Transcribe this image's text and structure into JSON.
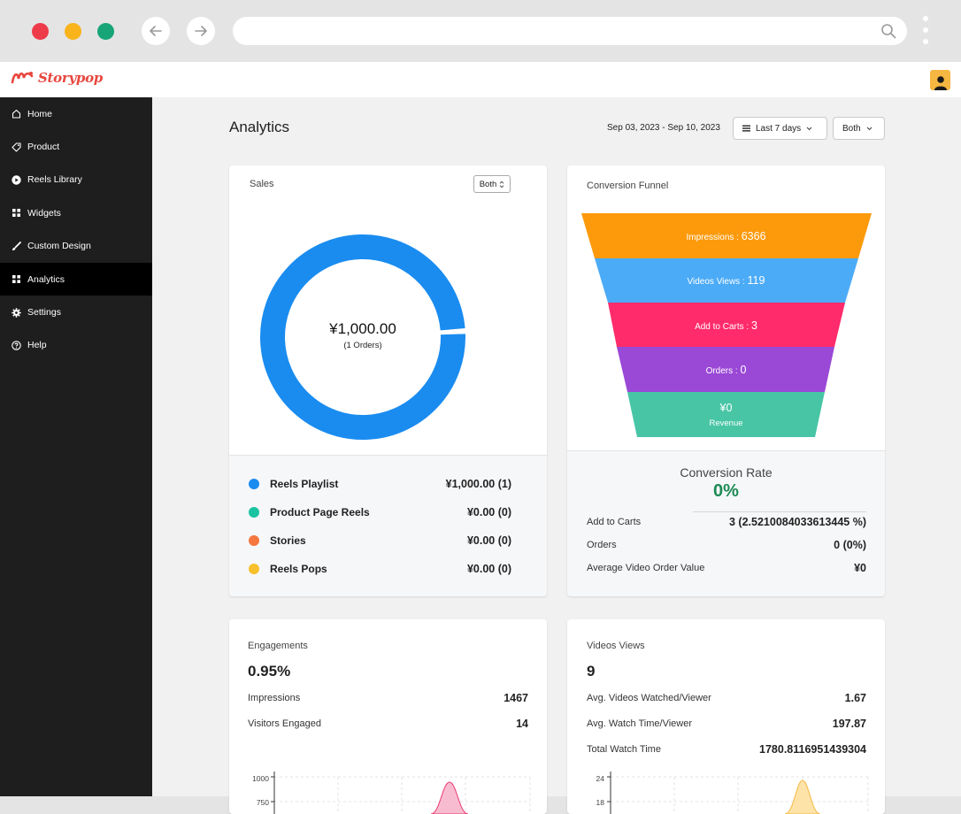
{
  "app": {
    "logo_text": "Storypop"
  },
  "sidebar": {
    "items": [
      {
        "label": "Home",
        "icon": "home-icon"
      },
      {
        "label": "Product",
        "icon": "tag-icon"
      },
      {
        "label": "Reels Library",
        "icon": "play-circle-icon"
      },
      {
        "label": "Widgets",
        "icon": "grid-icon"
      },
      {
        "label": "Custom Design",
        "icon": "brush-icon"
      },
      {
        "label": "Analytics",
        "icon": "grid-icon",
        "active": true
      },
      {
        "label": "Settings",
        "icon": "gear-icon"
      },
      {
        "label": "Help",
        "icon": "help-circle-icon"
      }
    ]
  },
  "header": {
    "title": "Analytics",
    "date_range": "Sep 03, 2023 - Sep 10, 2023",
    "period_select": "Last 7 days",
    "type_select": "Both"
  },
  "sales": {
    "title": "Sales",
    "filter": "Both",
    "total": "¥1,000.00",
    "orders": "(1 Orders)",
    "accent": "#1a8cf0",
    "legend": [
      {
        "label": "Reels Playlist",
        "value": "¥1,000.00 (1)",
        "color": "#1a8cf0"
      },
      {
        "label": "Product Page Reels",
        "value": "¥0.00 (0)",
        "color": "#19c2a0"
      },
      {
        "label": "Stories",
        "value": "¥0.00 (0)",
        "color": "#f5773f"
      },
      {
        "label": "Reels Pops",
        "value": "¥0.00 (0)",
        "color": "#f7c02c"
      }
    ]
  },
  "funnel": {
    "title": "Conversion Funnel",
    "stages": [
      {
        "label": "Impressions : ",
        "value": "6366",
        "color": "#fc9a0c"
      },
      {
        "label": "Videos Views : ",
        "value": "119",
        "color": "#4cabf7"
      },
      {
        "label": "Add to Carts : ",
        "value": "3",
        "color": "#ff2b6a"
      },
      {
        "label": "Orders : ",
        "value": "0",
        "color": "#9a48d6"
      },
      {
        "label": "Revenue",
        "value": "¥0",
        "color": "#47c5a5"
      }
    ],
    "conversion_title": "Conversion Rate",
    "conversion_value": "0%",
    "rows": [
      {
        "label": "Add to Carts",
        "value": "3 (2.5210084033613445 %)"
      },
      {
        "label": "Orders",
        "value": "0 (0%)"
      },
      {
        "label": "Average Video Order Value",
        "value": "¥0"
      }
    ]
  },
  "engagements": {
    "title": "Engagements",
    "value": "0.95%",
    "rows": [
      {
        "label": "Impressions",
        "value": "1467"
      },
      {
        "label": "Visitors Engaged",
        "value": "14"
      }
    ],
    "axis_ticks": [
      "1000",
      "750"
    ],
    "accent": "#f48fb1"
  },
  "videos": {
    "title": "Videos Views",
    "value": "9",
    "rows": [
      {
        "label": "Avg. Videos Watched/Viewer",
        "value": "1.67"
      },
      {
        "label": "Avg. Watch Time/Viewer",
        "value": "197.87"
      },
      {
        "label": "Total Watch Time",
        "value": "1780.8116951439304"
      }
    ],
    "axis_ticks": [
      "24",
      "18"
    ],
    "accent": "#fbd589"
  }
}
